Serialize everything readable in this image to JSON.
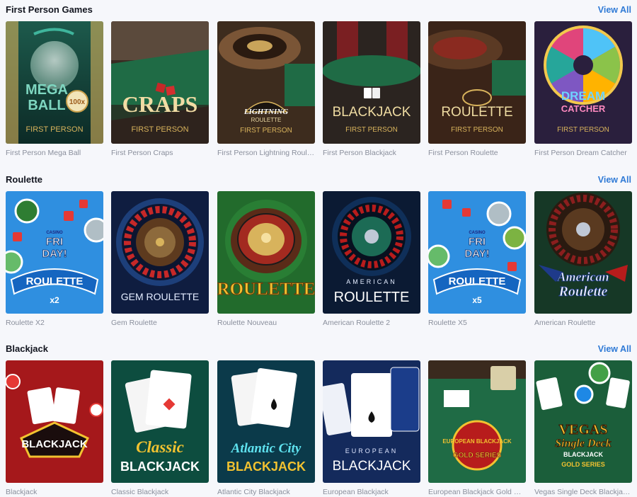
{
  "sections": [
    {
      "title": "First Person Games",
      "view_all": "View All",
      "games": [
        {
          "title": "First Person Mega Ball",
          "art": [
            "MEGA",
            "BALL",
            "FIRST PERSON"
          ],
          "badge": "100x"
        },
        {
          "title": "First Person Craps",
          "art": [
            "CRAPS",
            "FIRST PERSON"
          ]
        },
        {
          "title": "First Person Lightning Roulette",
          "art": [
            "LIGHTNING",
            "ROULETTE",
            "FIRST PERSON"
          ]
        },
        {
          "title": "First Person Blackjack",
          "art": [
            "BLACKJACK",
            "FIRST PERSON"
          ]
        },
        {
          "title": "First Person Roulette",
          "art": [
            "ROULETTE",
            "FIRST PERSON"
          ]
        },
        {
          "title": "First Person Dream Catcher",
          "art": [
            "DREAM",
            "CATCHER",
            "FIRST PERSON"
          ]
        }
      ]
    },
    {
      "title": "Roulette",
      "view_all": "View All",
      "games": [
        {
          "title": "Roulette X2",
          "art": [
            "CASINO",
            "FRI",
            "DAY!",
            "ROULETTE",
            "x2"
          ]
        },
        {
          "title": "Gem Roulette",
          "art": [
            "GEM ROULETTE"
          ]
        },
        {
          "title": "Roulette Nouveau",
          "art": [
            "ROULETTE"
          ]
        },
        {
          "title": "American Roulette 2",
          "art": [
            "AMERICAN",
            "ROULETTE"
          ]
        },
        {
          "title": "Roulette X5",
          "art": [
            "CASINO",
            "FRI",
            "DAY!",
            "ROULETTE",
            "x5"
          ]
        },
        {
          "title": "American Roulette",
          "art": [
            "American",
            "Roulette"
          ]
        }
      ]
    },
    {
      "title": "Blackjack",
      "view_all": "View All",
      "games": [
        {
          "title": "Blackjack",
          "art": [
            "BLACKJACK"
          ]
        },
        {
          "title": "Classic Blackjack",
          "art": [
            "Classic",
            "BLACKJACK"
          ]
        },
        {
          "title": "Atlantic City Blackjack",
          "art": [
            "Atlantic City",
            "BLACKJACK"
          ]
        },
        {
          "title": "European Blackjack",
          "art": [
            "EUROPEAN",
            "BLACKJACK"
          ]
        },
        {
          "title": "European Blackjack Gold Series",
          "art": [
            "EUROPEAN BLACKJACK",
            "GOLD SERIES"
          ]
        },
        {
          "title": "Vegas Single Deck Blackjack Gold Series",
          "art": [
            "VEGAS",
            "Single Deck",
            "BLACKJACK",
            "GOLD SERIES"
          ]
        }
      ]
    }
  ]
}
